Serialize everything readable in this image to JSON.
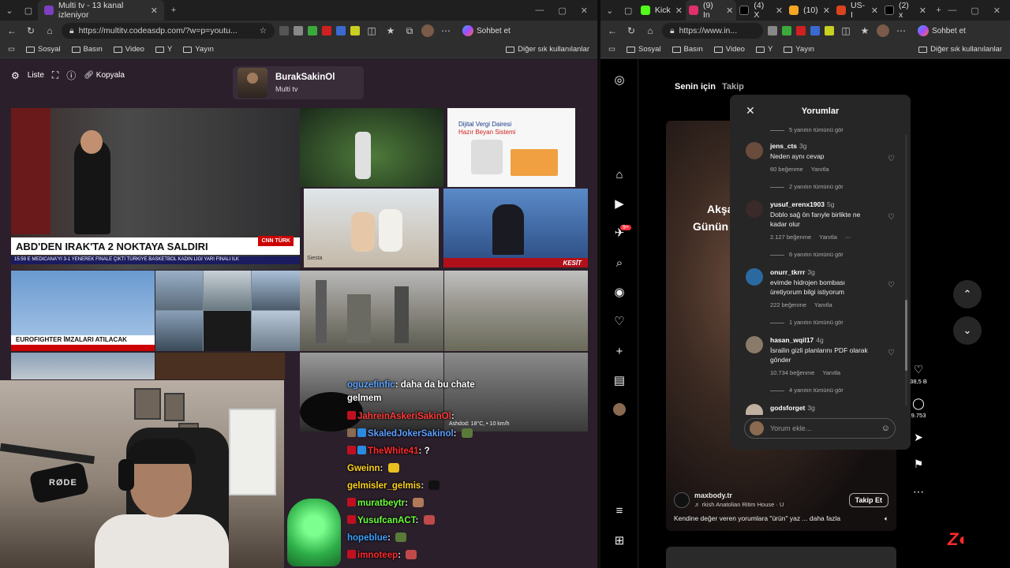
{
  "left_browser": {
    "tabs": [
      {
        "title": "Multi tv - 13 kanal izleniyor",
        "favicon_color": "#7b3fbf"
      }
    ],
    "url": "https://multitv.codeasdp.com/?w=p=youtu...",
    "copilot_label": "Sohbet et",
    "bookmarks": [
      "Sosyal",
      "Basın",
      "Video",
      "Y",
      "Yayın"
    ],
    "bookmarks_right": "Diğer sık kullanılanlar"
  },
  "right_browser": {
    "tabs": [
      {
        "title": "Kick",
        "favicon_color": "#53fc18"
      },
      {
        "title": "(9) In",
        "favicon_color": "#e1306c"
      },
      {
        "title": "(4) X",
        "favicon_color": "#000000"
      },
      {
        "title": "(10)",
        "favicon_color": "#f5a623"
      },
      {
        "title": "US-I",
        "favicon_color": "#d9441c"
      },
      {
        "title": "(2) x",
        "favicon_color": "#000000"
      }
    ],
    "url": "https://www.in...",
    "copilot_label": "Sohbet et",
    "bookmarks": [
      "Sosyal",
      "Basın",
      "Video",
      "Y",
      "Yayın"
    ],
    "bookmarks_right": "Diğer sık kullanılanlar"
  },
  "multitv": {
    "toolbar": {
      "list_label": "Liste",
      "copy_label": "Kopyala"
    },
    "channel": {
      "name": "BurakSakinOl",
      "subtitle": "Multi tv"
    },
    "tiles": {
      "news_banner": "ABD'DEN IRAK'TA 2 NOKTAYA SALDIRI",
      "news_ticker": "15:59  E MEDICANA'YI 3-1 YENEREK FİNALE ÇIKTI  TÜRKİYE BASKETBOL KADIN LİGİ YARI FİNALI İLK",
      "news_logo": "CNN TÜRK",
      "news2_banner": "EUROFIGHTER İMZALARI ATILACAK",
      "vergi_title": "Dijital Vergi Dairesi",
      "vergi_sub": "Hazır Beyan Sistemi",
      "kesit_label": "KESİT",
      "siesta_label": "Siesta",
      "weather_text": "Ashdod: 18°C, • 10 km/h"
    }
  },
  "chat": {
    "lines": [
      {
        "user": "oguzefinfic",
        "user_color": "#5aa0ff",
        "text": "daha da bu chate"
      },
      {
        "user": "",
        "user_color": "#ffffff",
        "text": "gelmem"
      },
      {
        "user": "JahreinAskeriSakinOl",
        "user_color": "#ff3a3a",
        "text": ""
      },
      {
        "user": "SkaledJokerSakinol",
        "user_color": "#5aa0ff",
        "text": ""
      },
      {
        "user": "TheWhite41",
        "user_color": "#ff2a2a",
        "text": "?"
      },
      {
        "user": "Gweinn",
        "user_color": "#ffd21a",
        "text": ""
      },
      {
        "user": "gelmisler_gelmis",
        "user_color": "#ffd21a",
        "text": ""
      },
      {
        "user": "muratbeytr",
        "user_color": "#6aff3a",
        "text": ""
      },
      {
        "user": "YusufcanACT",
        "user_color": "#6aff3a",
        "text": ""
      },
      {
        "user": "hopeblue",
        "user_color": "#3aa0ff",
        "text": ""
      },
      {
        "user": "imnoteep",
        "user_color": "#ff2a2a",
        "text": ""
      }
    ]
  },
  "instagram": {
    "tabs": [
      "Senin için",
      "Takip"
    ],
    "notification_count": "9+",
    "reel": {
      "overlay_line1": "Akşa",
      "overlay_line2": "Günün",
      "author": "maxbody.tr",
      "audio": "♬ rkish Anatolian Ritim House · U",
      "caption": "Kendine değer veren yorumlara \"ürün\" yaz ... daha fazla",
      "follow_label": "Takip Et"
    },
    "comments_panel": {
      "title": "Yorumlar",
      "top_replies": "5 yanıtın tümünü gör",
      "items": [
        {
          "user": "jens_cts",
          "age": "3g",
          "text": "Neden aynı cevap",
          "likes": "60 beğenme",
          "reply": "Yanıtla",
          "replies": "2 yanıtın tümünü gör",
          "avatar_color": "#6a4c3c"
        },
        {
          "user": "yusuf_erenx1903",
          "age": "5g",
          "text": "Doblo sağ ön farıyle birlikte ne kadar olur",
          "likes": "2.127 beğenme",
          "reply": "Yanıtla",
          "replies": "6 yanıtın tümünü gör",
          "avatar_color": "#3a2a2a"
        },
        {
          "user": "onurr_tkrrr",
          "age": "3g",
          "text": "evimde hidrojen bombası üretiyorum bilgi istiyorum",
          "likes": "222 beğenme",
          "reply": "Yanıtla",
          "replies": "1 yanıtın tümünü gör",
          "avatar_color": "#2a6aa0"
        },
        {
          "user": "hasan_wqil17",
          "age": "4g",
          "text": "İsrailin gizli planlarını PDF olarak gönder",
          "likes": "10.734 beğenme",
          "reply": "Yanıtla",
          "replies": "4 yanıtın tümünü gör",
          "avatar_color": "#8a7a6a"
        },
        {
          "user": "godsforget",
          "age": "3g",
          "text": "",
          "likes": "",
          "reply": "",
          "replies": "",
          "avatar_color": "#c0b0a0"
        }
      ],
      "input_placeholder": "Yorum ekle..."
    },
    "actions": [
      {
        "icon": "heart-icon",
        "count": "38,5 B"
      },
      {
        "icon": "comment-icon",
        "count": "9.753"
      },
      {
        "icon": "share-icon",
        "count": ""
      },
      {
        "icon": "bookmark-icon",
        "count": ""
      },
      {
        "icon": "more-icon",
        "count": ""
      }
    ]
  }
}
